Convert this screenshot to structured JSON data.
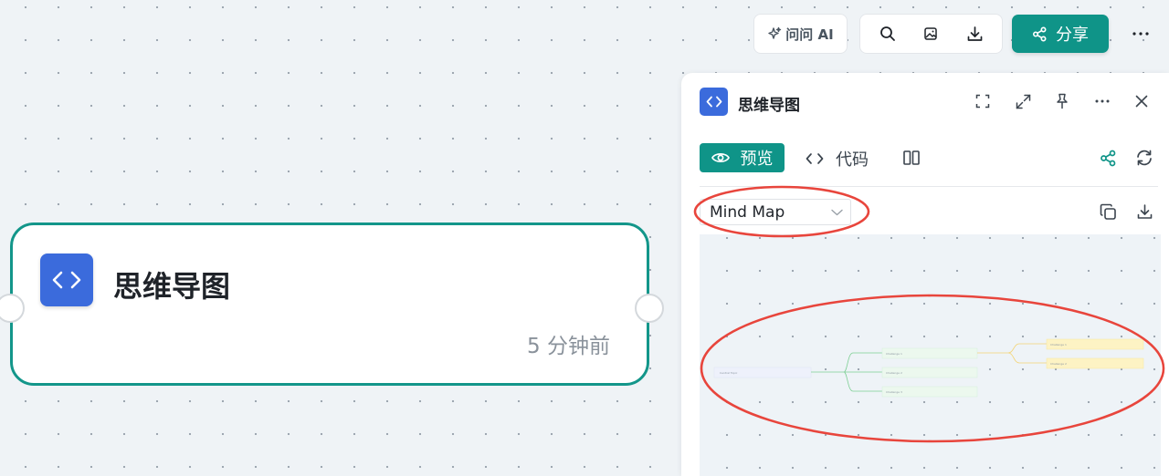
{
  "toolbar": {
    "ask_ai_label": "问问 AI",
    "share_label": "分享",
    "icons": [
      "sparkle-icon",
      "search-icon",
      "image-icon",
      "download-icon",
      "share-icon",
      "more-icon"
    ]
  },
  "node": {
    "title": "思维导图",
    "timestamp": "5 分钟前",
    "accent": "#13968a",
    "icon_color": "#3b6bdc"
  },
  "panel": {
    "title": "思维导图",
    "tabs": {
      "preview_label": "预览",
      "code_label": "代码"
    },
    "select": {
      "value": "Mind Map"
    },
    "mindmap": {
      "root": "Central Topic",
      "branches": [
        "Challenge 1",
        "Challenge 2",
        "Challenge 3"
      ],
      "sub_branches": [
        "Challenge 1",
        "Challenge 2"
      ]
    }
  },
  "colors": {
    "primary": "#0f9488",
    "annotation": "#e8453c",
    "branch_green": "#7ccf93",
    "branch_yellow": "#f3d476"
  }
}
